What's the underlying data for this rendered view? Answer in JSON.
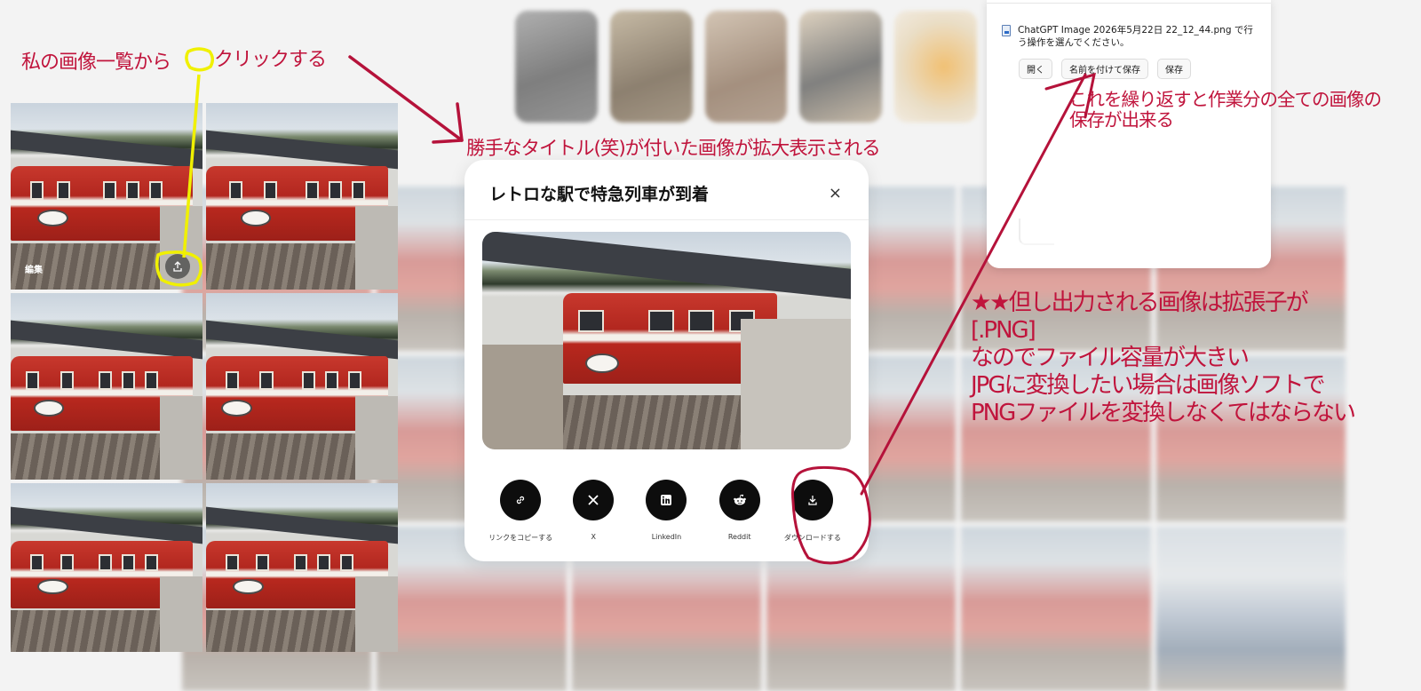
{
  "annotations": {
    "instruction_click_part1": "私の画像一覧から",
    "instruction_click_part2": "クリックする",
    "instruction_enlarged": "勝手なタイトル(笑)が付いた画像が拡大表示される",
    "instruction_repeat": "これを繰り返すと作業分の全ての画像の保存が出来る",
    "note_lines": [
      "★★但し出力される画像は拡張子が",
      "[.PNG]",
      "なのでファイル容量が大きい",
      "JPGに変換したい場合は画像ソフトで",
      "PNGファイルを変換しなくてはならない"
    ],
    "colors": {
      "annotation": "#c0143c",
      "highlight": "#f0f000"
    }
  },
  "gallery": {
    "edit_label": "編集",
    "share_icon": "upload-share-icon"
  },
  "modal": {
    "title": "レトロな駅で特急列車が到着",
    "close_symbol": "×",
    "share_options": [
      {
        "label": "リンクをコピーする",
        "icon": "link-icon"
      },
      {
        "label": "X",
        "icon": "x-logo-icon"
      },
      {
        "label": "LinkedIn",
        "icon": "linkedin-icon"
      },
      {
        "label": "Reddit",
        "icon": "reddit-icon"
      },
      {
        "label": "ダウンロードする",
        "icon": "download-icon"
      }
    ]
  },
  "download_panel": {
    "message": "ChatGPT Image 2026年5月22日 22_12_44.png で行う操作を選んでください。",
    "buttons": [
      "開く",
      "名前を付けて保存",
      "保存"
    ]
  }
}
